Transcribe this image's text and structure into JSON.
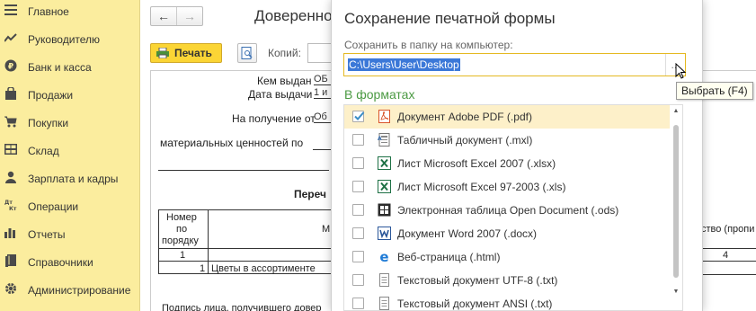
{
  "sidebar": {
    "items": [
      {
        "label": "Главное",
        "icon": "menu-icon"
      },
      {
        "label": "Руководителю",
        "icon": "trend-icon"
      },
      {
        "label": "Банк и касса",
        "icon": "coin-icon"
      },
      {
        "label": "Продажи",
        "icon": "bag-icon"
      },
      {
        "label": "Покупки",
        "icon": "cart-icon"
      },
      {
        "label": "Склад",
        "icon": "warehouse-icon"
      },
      {
        "label": "Зарплата и кадры",
        "icon": "person-icon"
      },
      {
        "label": "Операции",
        "icon": "dt-kt-icon"
      },
      {
        "label": "Отчеты",
        "icon": "bar-chart-icon"
      },
      {
        "label": "Справочники",
        "icon": "book-icon"
      },
      {
        "label": "Администрирование",
        "icon": "gear-icon"
      }
    ],
    "bg_color": "#fbed9e"
  },
  "document": {
    "nav_back": "←",
    "nav_forward": "→",
    "title": "Доверенно",
    "print_label": "Печать",
    "copies_label": "Копий:",
    "sheet": {
      "issued_label": "Кем выдан",
      "issued_value": "ОБ",
      "date_label": "Дата выдачи",
      "date_value": "1 и",
      "receive_label": "На получение от",
      "receive_value": "Об",
      "material_label": "материальных ценностей по",
      "list_heading": "Переч",
      "col_number": [
        "Номер",
        "по",
        "порядку"
      ],
      "col_m": "М",
      "col_qty": "ство (пропи",
      "row_index_1": "1",
      "row_index_4": "4",
      "row1_num": "1",
      "row1_name": "Цветы в ассортименте",
      "signature_text": "Подпись лица, получившего довер"
    }
  },
  "dialog": {
    "title": "Сохранение печатной формы",
    "folder_label": "Сохранить в папку на компьютер:",
    "folder_value": "C:\\Users\\User\\Desktop",
    "browse_button": "...",
    "formats_heading": "В форматах",
    "formats": [
      {
        "label": "Документ Adobe PDF (.pdf)",
        "checked": true,
        "icon": "pdf-icon"
      },
      {
        "label": "Табличный документ (.mxl)",
        "checked": false,
        "icon": "mxl-icon"
      },
      {
        "label": "Лист Microsoft Excel 2007 (.xlsx)",
        "checked": false,
        "icon": "excel-icon"
      },
      {
        "label": "Лист Microsoft Excel 97-2003 (.xls)",
        "checked": false,
        "icon": "excel-icon"
      },
      {
        "label": "Электронная таблица Open Document (.ods)",
        "checked": false,
        "icon": "ods-icon"
      },
      {
        "label": "Документ Word 2007 (.docx)",
        "checked": false,
        "icon": "word-icon"
      },
      {
        "label": "Веб-страница (.html)",
        "checked": false,
        "icon": "html-icon"
      },
      {
        "label": "Текстовый документ UTF-8 (.txt)",
        "checked": false,
        "icon": "txt-icon"
      },
      {
        "label": "Текстовый документ ANSI (.txt)",
        "checked": false,
        "icon": "txt-icon"
      }
    ]
  },
  "tooltip": {
    "text": "Выбрать (F4)"
  },
  "colors": {
    "accent": "#fbd535",
    "selection": "#3b78d8",
    "section": "#4b9a43",
    "check": "#3b8ec7"
  }
}
